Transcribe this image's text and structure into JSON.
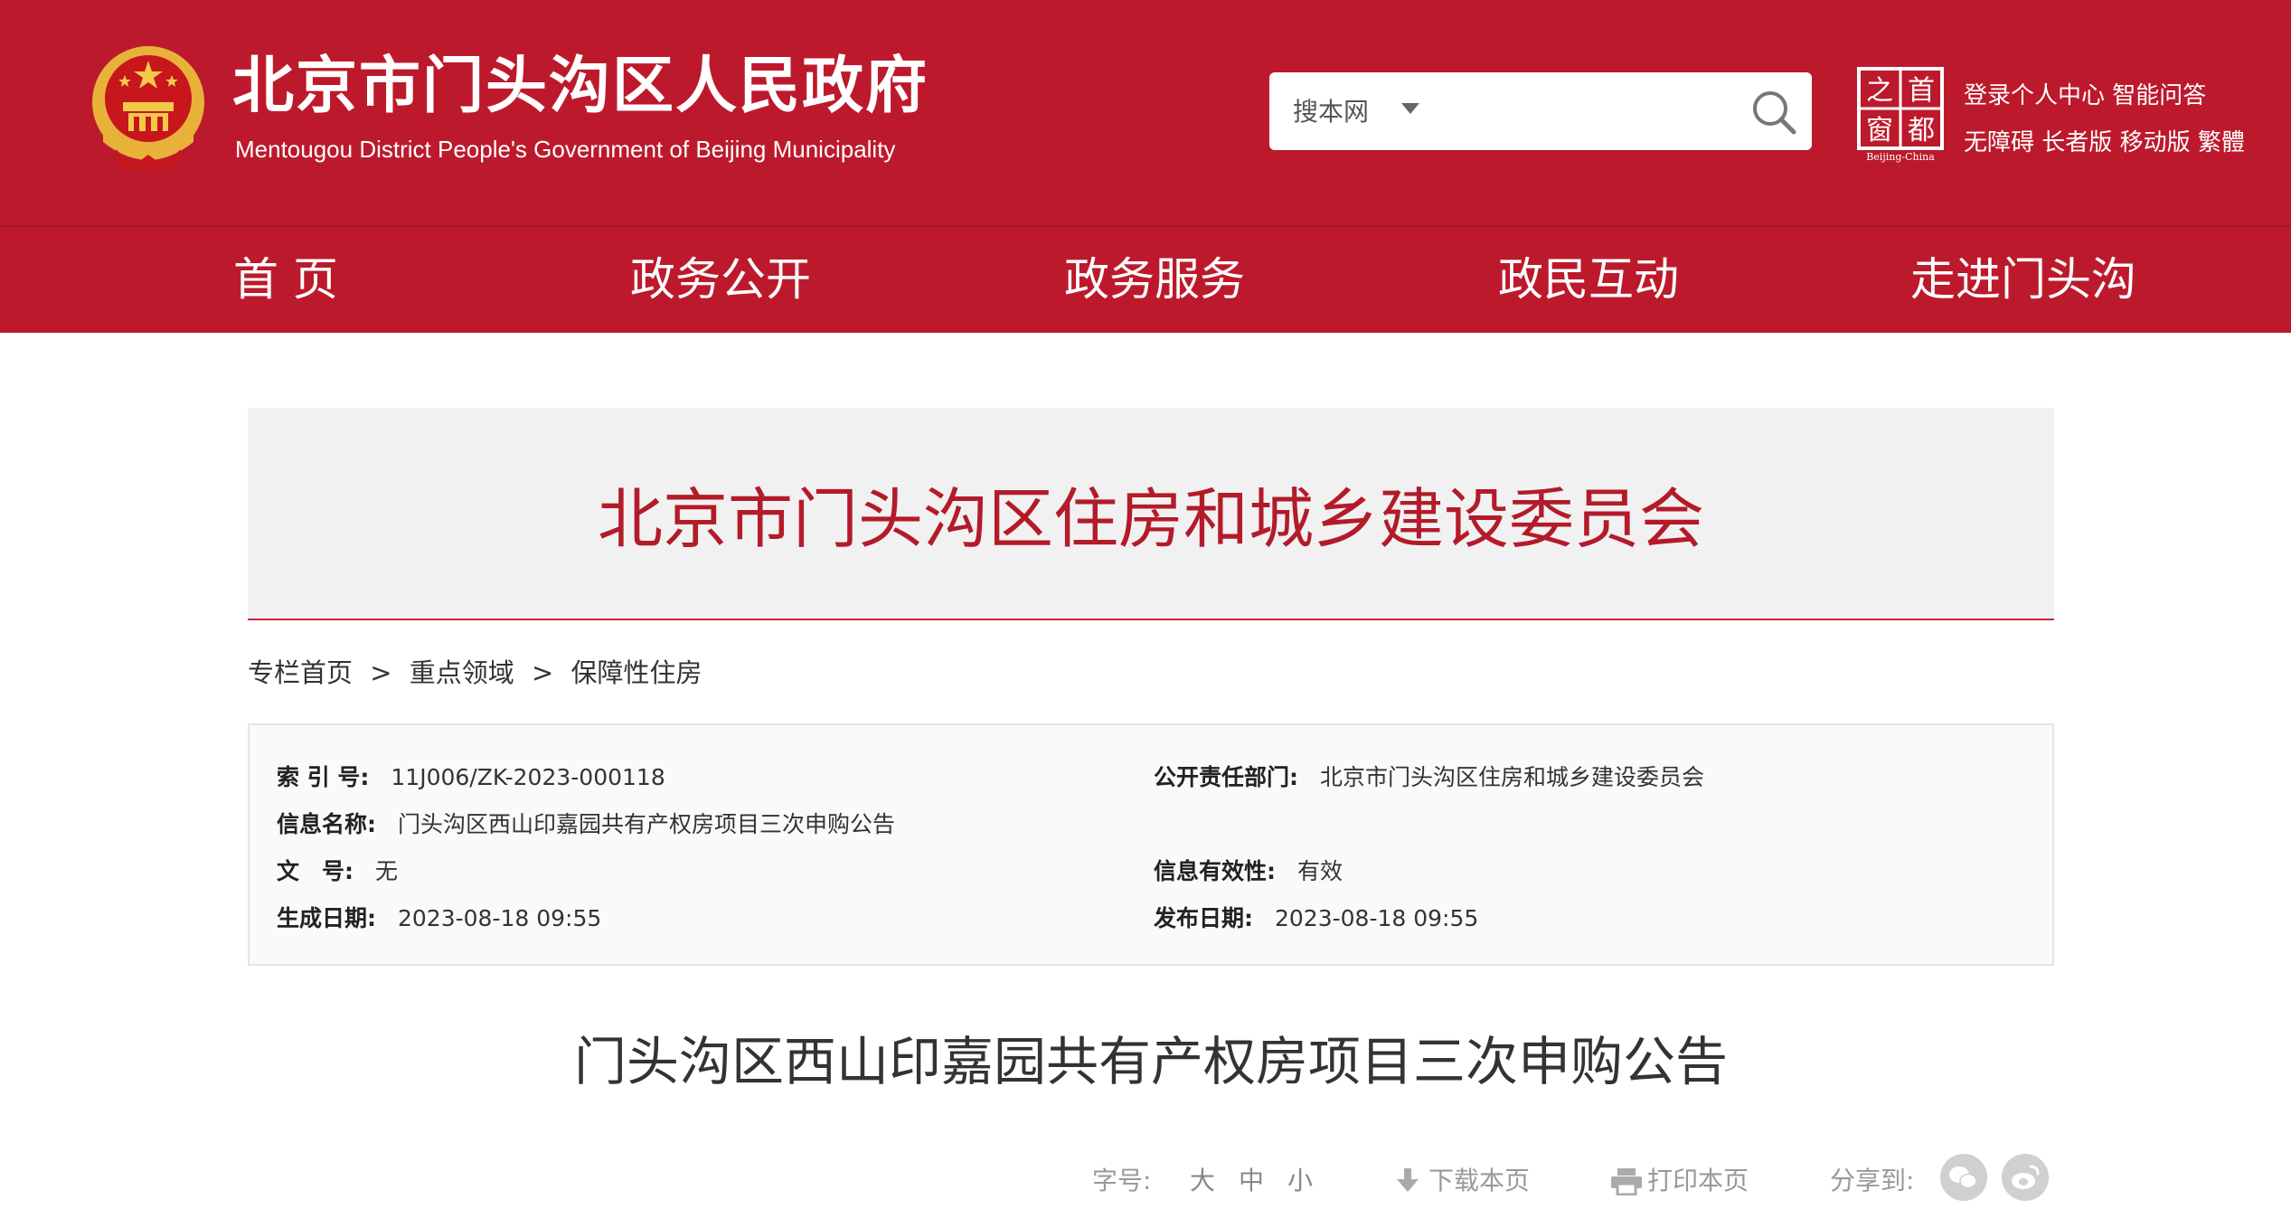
{
  "header": {
    "site_title": "北京市门头沟区人民政府",
    "site_subtitle": "Mentougou District People's Government of Beijing Municipality",
    "search": {
      "scope": "搜本网",
      "placeholder": ""
    },
    "capital_logo_text": [
      "首",
      "都",
      "之",
      "窗"
    ],
    "capital_logo_caption": "Beijing-China",
    "top_links_row1": [
      "登录个人中心",
      "智能问答"
    ],
    "top_links_row2": [
      "无障碍",
      "长者版",
      "移动版",
      "繁體"
    ]
  },
  "nav": {
    "items": [
      "首 页",
      "政务公开",
      "政务服务",
      "政民互动",
      "走进门头沟"
    ]
  },
  "column": {
    "title": "北京市门头沟区住房和城乡建设委员会"
  },
  "breadcrumb": [
    "专栏首页",
    ">",
    "重点领域",
    ">",
    "保障性住房"
  ],
  "info": {
    "index_label": "索 引 号:",
    "index_value": "11J006/ZK-2023-000118",
    "dept_label": "公开责任部门:",
    "dept_value": "北京市门头沟区住房和城乡建设委员会",
    "name_label": "信息名称:",
    "name_value": "门头沟区西山印嘉园共有产权房项目三次申购公告",
    "docno_label": "文　号:",
    "docno_value": "无",
    "validity_label": "信息有效性:",
    "validity_value": "有效",
    "created_label": "生成日期:",
    "created_value": "2023-08-18 09:55",
    "published_label": "发布日期:",
    "published_value": "2023-08-18 09:55"
  },
  "article": {
    "title": "门头沟区西山印嘉园共有产权房项目三次申购公告"
  },
  "tools": {
    "font_label": "字号:",
    "font_large": "大",
    "font_medium": "中",
    "font_small": "小",
    "download": "下载本页",
    "print": "打印本页",
    "share": "分享到:"
  },
  "colors": {
    "brand_red": "#bc1a2c",
    "column_title_red": "#b31b2a"
  },
  "icons": [
    "national-emblem-icon",
    "search-icon",
    "capital-window-logo",
    "download-icon",
    "print-icon",
    "wechat-icon",
    "weibo-icon"
  ]
}
